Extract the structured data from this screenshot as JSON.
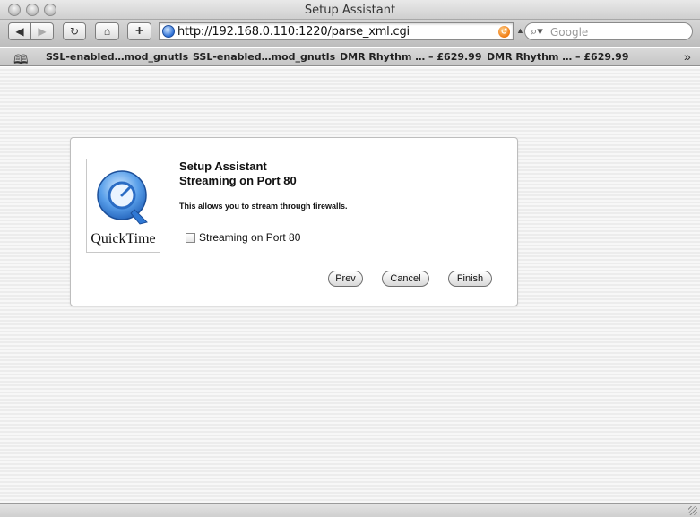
{
  "window": {
    "title": "Setup Assistant"
  },
  "toolbar": {
    "back_icon": "back-arrow-icon",
    "forward_icon": "forward-arrow-icon",
    "back_glyph": "◀",
    "forward_glyph": "▶",
    "reload_glyph": "↻",
    "home_glyph": "⌂",
    "add_glyph": "+",
    "address": "http://192.168.0.110:1220/parse_xml.cgi",
    "search_placeholder": "Google",
    "search_glyph": "⌕▾"
  },
  "bookmarks": {
    "items": [
      {
        "label": "SSL-enabled…mod_gnutls"
      },
      {
        "label": "SSL-enabled…mod_gnutls"
      },
      {
        "label": "DMR Rhythm … – £629.99"
      },
      {
        "label": "DMR Rhythm … – £629.99"
      }
    ],
    "more_glyph": "»",
    "book_glyph": "📖"
  },
  "dialog": {
    "logo_text": "QuickTime",
    "title_line1": "Setup Assistant",
    "title_line2": "Streaming on Port 80",
    "description": "This allows you to stream through firewalls.",
    "checkbox_label": "Streaming on Port 80",
    "checkbox_checked": false,
    "buttons": {
      "prev": "Prev",
      "cancel": "Cancel",
      "finish": "Finish"
    }
  },
  "colors": {
    "quicktime_blue": "#3a86d6",
    "rss_orange": "#f07a10"
  }
}
